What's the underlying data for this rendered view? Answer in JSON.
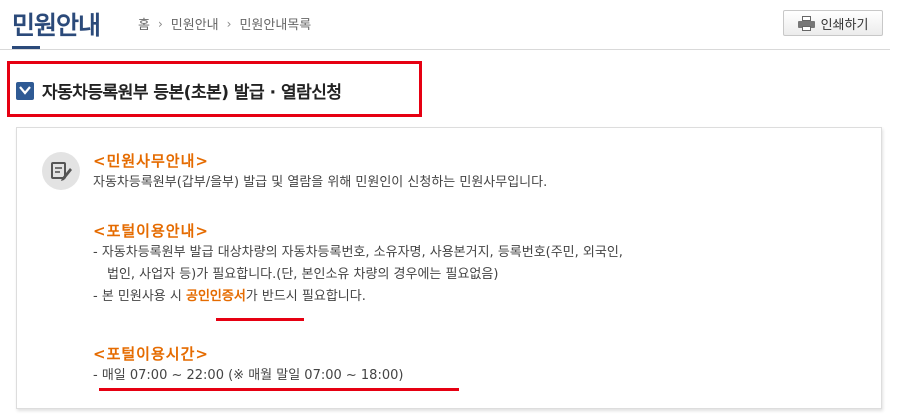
{
  "header": {
    "title": "민원안내",
    "breadcrumb": [
      "홈",
      "민원안내",
      "민원안내목록"
    ],
    "print_label": "인쇄하기"
  },
  "section": {
    "title": "자동차등록원부 등본(초본) 발급 · 열람신청"
  },
  "info": {
    "office_heading": "<민원사무안내>",
    "office_text": "자동차등록원부(갑부/을부) 발급 및 열람을 위해 민원인이 신청하는 민원사무입니다.",
    "portal_heading": "<포털이용안내>",
    "portal_line1": "- 자동차등록원부 발급 대상차량의 자동차등록번호, 소유자명, 사용본거지, 등록번호(주민, 외국인,",
    "portal_line2": "법인, 사업자 등)가 필요합니다.(단, 본인소유 차량의 경우에는 필요없음)",
    "portal_line3_pre": "- 본 민원사용 시 ",
    "portal_line3_highlight": "공인인증서",
    "portal_line3_post": "가 반드시 필요합니다.",
    "hours_heading": "<포털이용시간>",
    "hours_text": "- 매일 07:00 ~ 22:00 (※ 매월 말일 07:00 ~ 18:00)"
  },
  "colors": {
    "title": "#2b4a7a",
    "accent": "#e56b00",
    "highlight_box": "#e60012"
  }
}
